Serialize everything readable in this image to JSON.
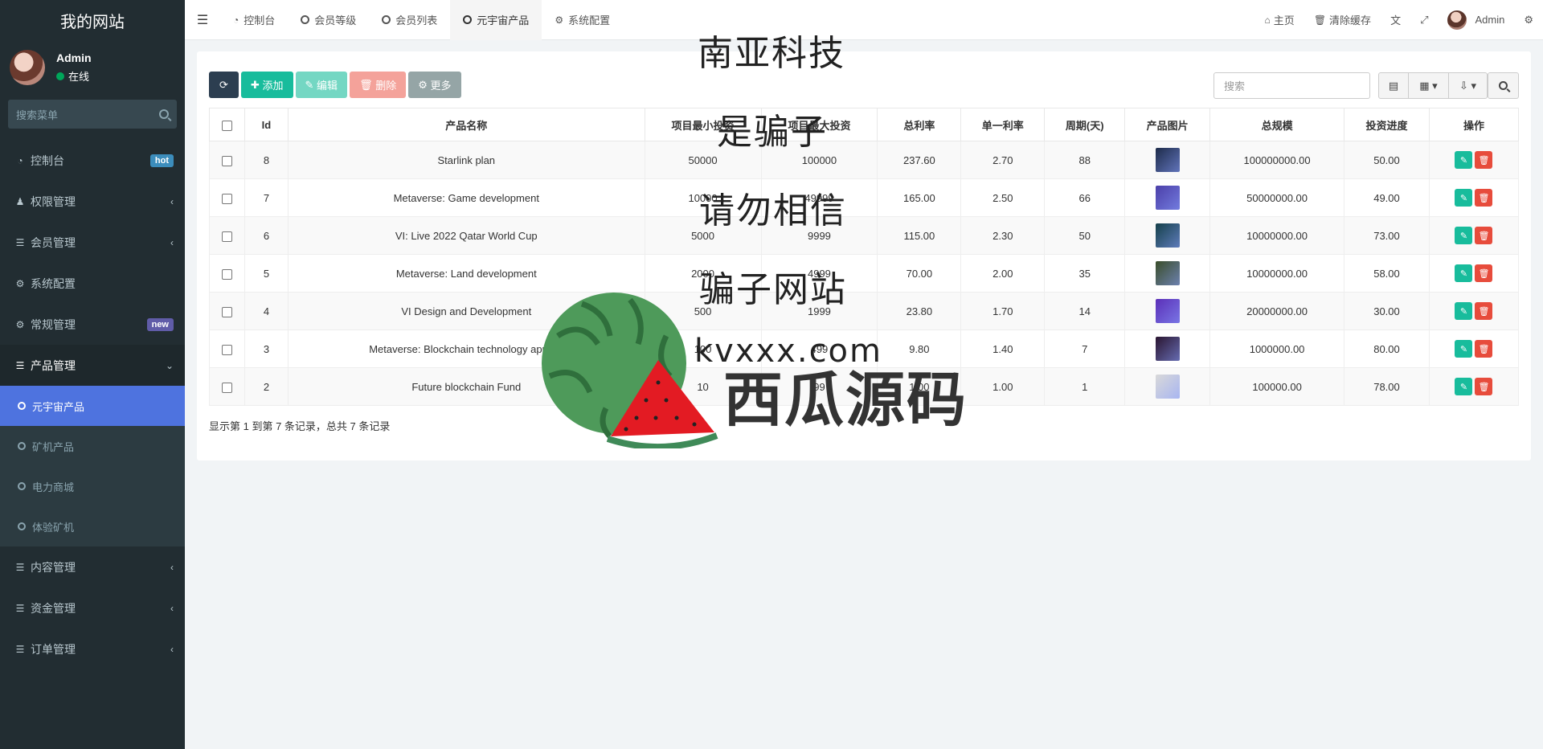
{
  "sidebar": {
    "brand": "我的网站",
    "user": {
      "name": "Admin",
      "status": "在线"
    },
    "search_placeholder": "搜索菜单",
    "items": [
      {
        "label": "控制台",
        "badge": "hot"
      },
      {
        "label": "权限管理"
      },
      {
        "label": "会员管理"
      },
      {
        "label": "系统配置"
      },
      {
        "label": "常规管理",
        "badge": "new"
      },
      {
        "label": "产品管理"
      }
    ],
    "submenu": [
      {
        "label": "元宇宙产品"
      },
      {
        "label": "矿机产品"
      },
      {
        "label": "电力商城"
      },
      {
        "label": "体验矿机"
      }
    ],
    "items_after": [
      {
        "label": "内容管理"
      },
      {
        "label": "资金管理"
      },
      {
        "label": "订单管理"
      }
    ]
  },
  "topbar": {
    "tabs": [
      {
        "label": "控制台"
      },
      {
        "label": "会员等级"
      },
      {
        "label": "会员列表"
      },
      {
        "label": "元宇宙产品"
      },
      {
        "label": "系统配置"
      }
    ],
    "right": {
      "home": "主页",
      "clear_cache": "清除缓存",
      "user": "Admin"
    }
  },
  "toolbar": {
    "add": "添加",
    "edit": "编辑",
    "delete": "删除",
    "more": "更多",
    "search_placeholder": "搜索"
  },
  "table": {
    "headers": [
      "Id",
      "产品名称",
      "项目最小投资",
      "项目最大投资",
      "总利率",
      "单一利率",
      "周期(天)",
      "产品图片",
      "总规模",
      "投资进度",
      "操作"
    ],
    "rows": [
      {
        "id": "8",
        "name": "Starlink plan",
        "min": "50000",
        "max": "100000",
        "total_rate": "237.60",
        "single_rate": "2.70",
        "cycle": "88",
        "scale": "100000000.00",
        "progress": "50.00",
        "thumb": "#1d2b4a"
      },
      {
        "id": "7",
        "name": "Metaverse: Game development",
        "min": "10000",
        "max": "49999",
        "total_rate": "165.00",
        "single_rate": "2.50",
        "cycle": "66",
        "scale": "50000000.00",
        "progress": "49.00",
        "thumb": "#4b3fa8"
      },
      {
        "id": "6",
        "name": "VI: Live 2022 Qatar World Cup",
        "min": "5000",
        "max": "9999",
        "total_rate": "115.00",
        "single_rate": "2.30",
        "cycle": "50",
        "scale": "10000000.00",
        "progress": "73.00",
        "thumb": "#15404a"
      },
      {
        "id": "5",
        "name": "Metaverse: Land development",
        "min": "2000",
        "max": "4999",
        "total_rate": "70.00",
        "single_rate": "2.00",
        "cycle": "35",
        "scale": "10000000.00",
        "progress": "58.00",
        "thumb": "#3a4d2a"
      },
      {
        "id": "4",
        "name": "VI Design and Development",
        "min": "500",
        "max": "1999",
        "total_rate": "23.80",
        "single_rate": "1.70",
        "cycle": "14",
        "scale": "20000000.00",
        "progress": "30.00",
        "thumb": "#5b2fb8"
      },
      {
        "id": "3",
        "name": "Metaverse: Blockchain technology applica",
        "min": "100",
        "max": "499",
        "total_rate": "9.80",
        "single_rate": "1.40",
        "cycle": "7",
        "scale": "1000000.00",
        "progress": "80.00",
        "thumb": "#2a1530"
      },
      {
        "id": "2",
        "name": "Future blockchain Fund",
        "min": "10",
        "max": "99",
        "total_rate": "1.00",
        "single_rate": "1.00",
        "cycle": "1",
        "scale": "100000.00",
        "progress": "78.00",
        "thumb": "#d9d9d9"
      }
    ]
  },
  "pager": "显示第 1 到第 7 条记录，总共 7 条记录",
  "overlay": {
    "lines": [
      "南亚科技",
      "是骗子",
      "请勿相信",
      "骗子网站",
      "kvxxx.com"
    ],
    "brand": "西瓜源码"
  }
}
